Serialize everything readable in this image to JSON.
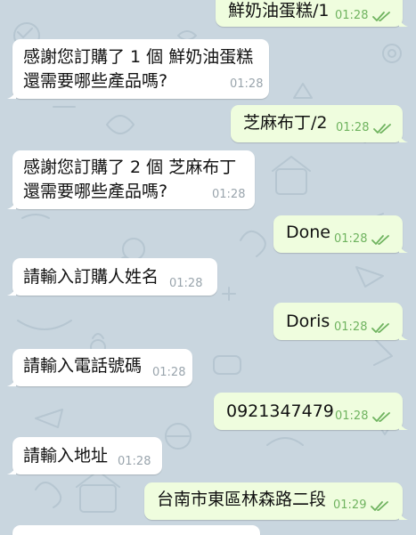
{
  "theme": {
    "wallpaper": "#c9d6df",
    "incoming_bubble": "#ffffff",
    "outgoing_bubble": "#effdde",
    "time_out_color": "#6fb35f",
    "time_in_color": "#9aa5ad"
  },
  "messages": [
    {
      "dir": "out",
      "lines": [
        "鮮奶油蛋糕/1"
      ],
      "time": "01:28",
      "read_icon": "double-check-icon"
    },
    {
      "dir": "in",
      "lines": [
        "感謝您訂購了 1 個 鮮奶油蛋糕",
        "還需要哪些產品嗎?"
      ],
      "time": "01:28"
    },
    {
      "dir": "out",
      "lines": [
        "芝麻布丁/2"
      ],
      "time": "01:28",
      "read_icon": "double-check-icon"
    },
    {
      "dir": "in",
      "lines": [
        "感謝您訂購了 2 個 芝麻布丁",
        "還需要哪些產品嗎?"
      ],
      "time": "01:28"
    },
    {
      "dir": "out",
      "lines": [
        "Done"
      ],
      "time": "01:28",
      "read_icon": "double-check-icon"
    },
    {
      "dir": "in",
      "lines": [
        "請輸入訂購人姓名"
      ],
      "time": "01:28"
    },
    {
      "dir": "out",
      "lines": [
        "Doris"
      ],
      "time": "01:28",
      "read_icon": "double-check-icon"
    },
    {
      "dir": "in",
      "lines": [
        "請輸入電話號碼"
      ],
      "time": "01:28"
    },
    {
      "dir": "out",
      "lines": [
        "0921347479"
      ],
      "time": "01:28",
      "read_icon": "double-check-icon"
    },
    {
      "dir": "in",
      "lines": [
        "請輸入地址"
      ],
      "time": "01:28"
    },
    {
      "dir": "out",
      "lines": [
        "台南市東區林森路二段"
      ],
      "time": "01:29",
      "read_icon": "double-check-icon"
    },
    {
      "dir": "in",
      "lines": [
        ""
      ],
      "time": ""
    }
  ]
}
